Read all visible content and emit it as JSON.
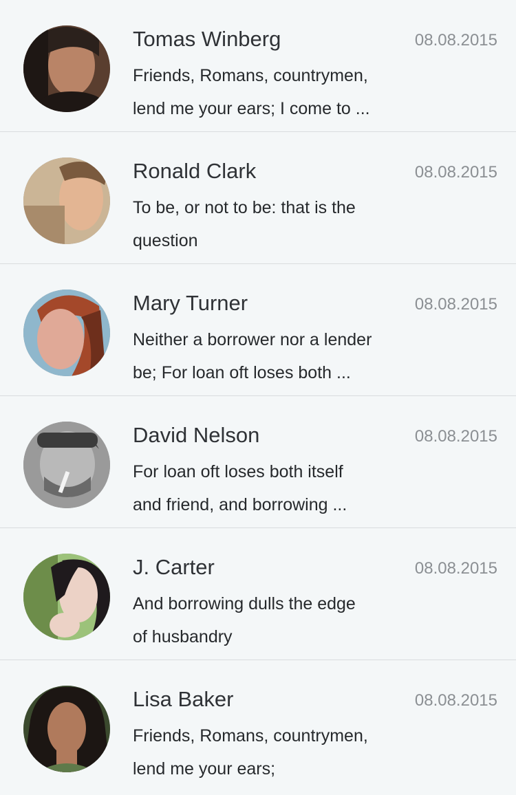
{
  "messages": [
    {
      "name": "Tomas Winberg",
      "date": "08.08.2015",
      "preview_line1": "Friends, Romans, countrymen,",
      "preview_line2": "lend me your ears; I come to ...",
      "avatar": {
        "bg": "#5a3e2f",
        "skin": "#b98467",
        "hair": "#2b211c",
        "accent": "#1e1714"
      }
    },
    {
      "name": "Ronald Clark",
      "date": "08.08.2015",
      "preview_line1": "To be, or not to be: that is the",
      "preview_line2": "question",
      "avatar": {
        "bg": "#cbb596",
        "skin": "#e3b593",
        "hair": "#7a5a3e",
        "accent": "#a88b6b"
      }
    },
    {
      "name": "Mary Turner",
      "date": "08.08.2015",
      "preview_line1": "Neither a borrower nor a lender",
      "preview_line2": "be; For loan oft loses both ...",
      "avatar": {
        "bg": "#8fb7cc",
        "skin": "#e0a997",
        "hair": "#a4482a",
        "accent": "#6e2f1c"
      }
    },
    {
      "name": "David Nelson",
      "date": "08.08.2015",
      "preview_line1": "For loan oft loses both itself",
      "preview_line2": "and friend, and borrowing ...",
      "avatar": {
        "bg": "#9a9a9a",
        "skin": "#b9b9b9",
        "hair": "#3c3c3c",
        "accent": "#6a6a6a"
      }
    },
    {
      "name": "J. Carter",
      "date": "08.08.2015",
      "preview_line1": "And borrowing dulls the edge",
      "preview_line2": "of husbandry",
      "avatar": {
        "bg": "#9cc27a",
        "skin": "#ecd2c6",
        "hair": "#1f1a1d",
        "accent": "#6d8d4a"
      }
    },
    {
      "name": "Lisa Baker",
      "date": "08.08.2015",
      "preview_line1": "Friends, Romans, countrymen,",
      "preview_line2": "lend me your ears;",
      "avatar": {
        "bg": "#3b4a2e",
        "skin": "#b07a5c",
        "hair": "#1c1613",
        "accent": "#5e7a4a"
      }
    }
  ]
}
